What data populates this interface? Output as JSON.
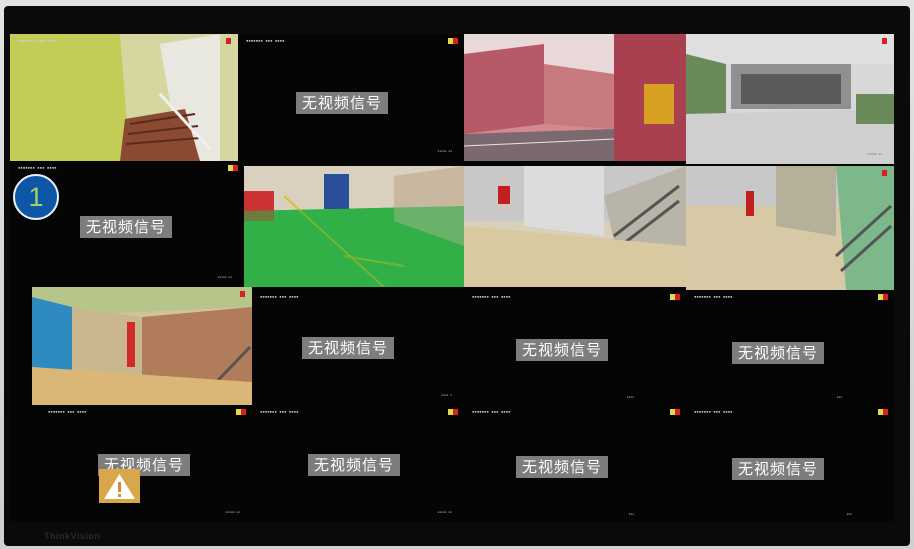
{
  "app": {
    "name": "CCTV monitoring wall",
    "monitor_brand": "ThinkVision"
  },
  "no_signal_text": "无视频信号",
  "tiles": [
    {
      "id": 1,
      "state": "live",
      "scene": "yellow stairwell"
    },
    {
      "id": 2,
      "state": "no_signal",
      "label": "无视频信号"
    },
    {
      "id": 3,
      "state": "live",
      "scene": "campus street"
    },
    {
      "id": 4,
      "state": "live",
      "scene": "courtyard"
    },
    {
      "id": 5,
      "state": "no_signal",
      "label": "无视频信号",
      "selected_badge": "1"
    },
    {
      "id": 6,
      "state": "live",
      "scene": "green hallway"
    },
    {
      "id": 7,
      "state": "live",
      "scene": "stairwell"
    },
    {
      "id": 8,
      "state": "live",
      "scene": "stairwell"
    },
    {
      "id": 9,
      "state": "live",
      "scene": "corridor"
    },
    {
      "id": 10,
      "state": "no_signal",
      "label": "无视频信号"
    },
    {
      "id": 11,
      "state": "no_signal",
      "label": "无视频信号"
    },
    {
      "id": 12,
      "state": "no_signal",
      "label": "无视频信号"
    },
    {
      "id": 13,
      "state": "no_signal",
      "label": "无视频信号",
      "warning": true
    },
    {
      "id": 14,
      "state": "no_signal",
      "label": "无视频信号"
    },
    {
      "id": 15,
      "state": "no_signal",
      "label": "无视频信号"
    },
    {
      "id": 16,
      "state": "no_signal",
      "label": "无视频信号"
    }
  ],
  "selected_badge_label": "1",
  "colors": {
    "badge": "#0d57a6",
    "badge_digit": "#9fd06a",
    "label_bg": "#7d7d7d",
    "rec_red": "#d82222",
    "rec_yellow": "#e4d94a",
    "warning": "#d9a64a"
  },
  "icons": [
    "warning-icon",
    "record-indicator-icon"
  ]
}
